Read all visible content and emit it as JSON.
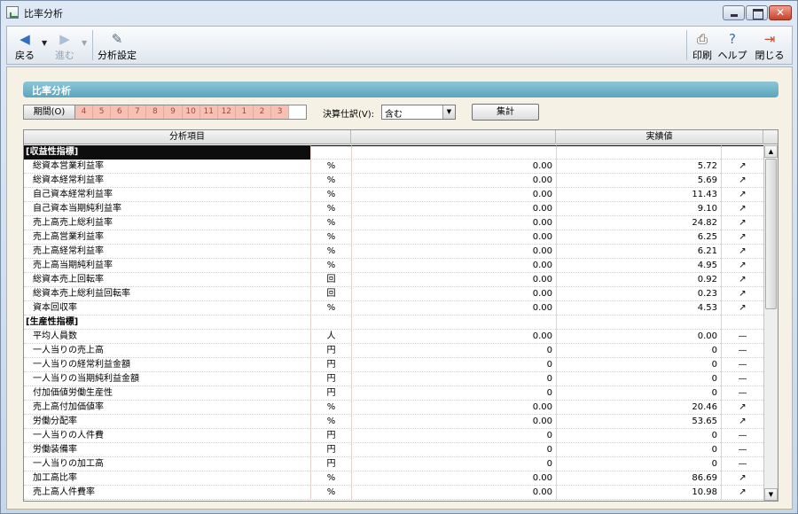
{
  "window": {
    "title": "比率分析"
  },
  "toolbar": {
    "back": "戻る",
    "forward": "進む",
    "settings": "分析設定",
    "print": "印刷",
    "help": "ヘルプ",
    "close": "閉じる"
  },
  "section": {
    "title": "比率分析"
  },
  "period": {
    "label": "期間(O)",
    "months": [
      "4",
      "5",
      "6",
      "7",
      "8",
      "9",
      "10",
      "11",
      "12",
      "1",
      "2",
      "3"
    ]
  },
  "settlement": {
    "label": "決算仕訳(V):",
    "value": "含む"
  },
  "calc_button": "集計",
  "table": {
    "headers": {
      "item": "分析項目",
      "actual": "実績値"
    },
    "rows": [
      {
        "kind": "category",
        "name": "[収益性指標]",
        "unit": "",
        "v1": "",
        "v2": "",
        "trend": ""
      },
      {
        "kind": "item",
        "name": "総資本営業利益率",
        "unit": "%",
        "v1": "0.00",
        "v2": "5.72",
        "trend": "↗"
      },
      {
        "kind": "item",
        "name": "総資本経常利益率",
        "unit": "%",
        "v1": "0.00",
        "v2": "5.69",
        "trend": "↗"
      },
      {
        "kind": "item",
        "name": "自己資本経常利益率",
        "unit": "%",
        "v1": "0.00",
        "v2": "11.43",
        "trend": "↗"
      },
      {
        "kind": "item",
        "name": "自己資本当期純利益率",
        "unit": "%",
        "v1": "0.00",
        "v2": "9.10",
        "trend": "↗"
      },
      {
        "kind": "item",
        "name": "売上高売上総利益率",
        "unit": "%",
        "v1": "0.00",
        "v2": "24.82",
        "trend": "↗"
      },
      {
        "kind": "item",
        "name": "売上高営業利益率",
        "unit": "%",
        "v1": "0.00",
        "v2": "6.25",
        "trend": "↗"
      },
      {
        "kind": "item",
        "name": "売上高経常利益率",
        "unit": "%",
        "v1": "0.00",
        "v2": "6.21",
        "trend": "↗"
      },
      {
        "kind": "item",
        "name": "売上高当期純利益率",
        "unit": "%",
        "v1": "0.00",
        "v2": "4.95",
        "trend": "↗"
      },
      {
        "kind": "item",
        "name": "総資本売上回転率",
        "unit": "回",
        "v1": "0.00",
        "v2": "0.92",
        "trend": "↗"
      },
      {
        "kind": "item",
        "name": "総資本売上総利益回転率",
        "unit": "回",
        "v1": "0.00",
        "v2": "0.23",
        "trend": "↗"
      },
      {
        "kind": "item",
        "name": "資本回収率",
        "unit": "%",
        "v1": "0.00",
        "v2": "4.53",
        "trend": "↗"
      },
      {
        "kind": "category",
        "name": "[生産性指標]",
        "unit": "",
        "v1": "",
        "v2": "",
        "trend": ""
      },
      {
        "kind": "item",
        "name": "平均人員数",
        "unit": "人",
        "v1": "0.00",
        "v2": "0.00",
        "trend": "—"
      },
      {
        "kind": "item",
        "name": "一人当りの売上高",
        "unit": "円",
        "v1": "0",
        "v2": "0",
        "trend": "—"
      },
      {
        "kind": "item",
        "name": "一人当りの経常利益金額",
        "unit": "円",
        "v1": "0",
        "v2": "0",
        "trend": "—"
      },
      {
        "kind": "item",
        "name": "一人当りの当期純利益金額",
        "unit": "円",
        "v1": "0",
        "v2": "0",
        "trend": "—"
      },
      {
        "kind": "item",
        "name": "付加価値労働生産性",
        "unit": "円",
        "v1": "0",
        "v2": "0",
        "trend": "—"
      },
      {
        "kind": "item",
        "name": "売上高付加価値率",
        "unit": "%",
        "v1": "0.00",
        "v2": "20.46",
        "trend": "↗"
      },
      {
        "kind": "item",
        "name": "労働分配率",
        "unit": "%",
        "v1": "0.00",
        "v2": "53.65",
        "trend": "↗"
      },
      {
        "kind": "item",
        "name": "一人当りの人件費",
        "unit": "円",
        "v1": "0",
        "v2": "0",
        "trend": "—"
      },
      {
        "kind": "item",
        "name": "労働装備率",
        "unit": "円",
        "v1": "0",
        "v2": "0",
        "trend": "—"
      },
      {
        "kind": "item",
        "name": "一人当りの加工高",
        "unit": "円",
        "v1": "0",
        "v2": "0",
        "trend": "—"
      },
      {
        "kind": "item",
        "name": "加工高比率",
        "unit": "%",
        "v1": "0.00",
        "v2": "86.69",
        "trend": "↗"
      },
      {
        "kind": "item",
        "name": "売上高人件費率",
        "unit": "%",
        "v1": "0.00",
        "v2": "10.98",
        "trend": "↗"
      }
    ]
  },
  "icons": {
    "back": "arrow-left-icon",
    "forward": "arrow-right-icon",
    "settings": "chart-settings-icon",
    "print": "printer-icon",
    "help": "help-icon",
    "close": "door-exit-icon"
  },
  "colors": {
    "section_header": "#6fb3c9",
    "period_cell": "#f6c1b4",
    "category_dark": "#0d0d0d"
  }
}
